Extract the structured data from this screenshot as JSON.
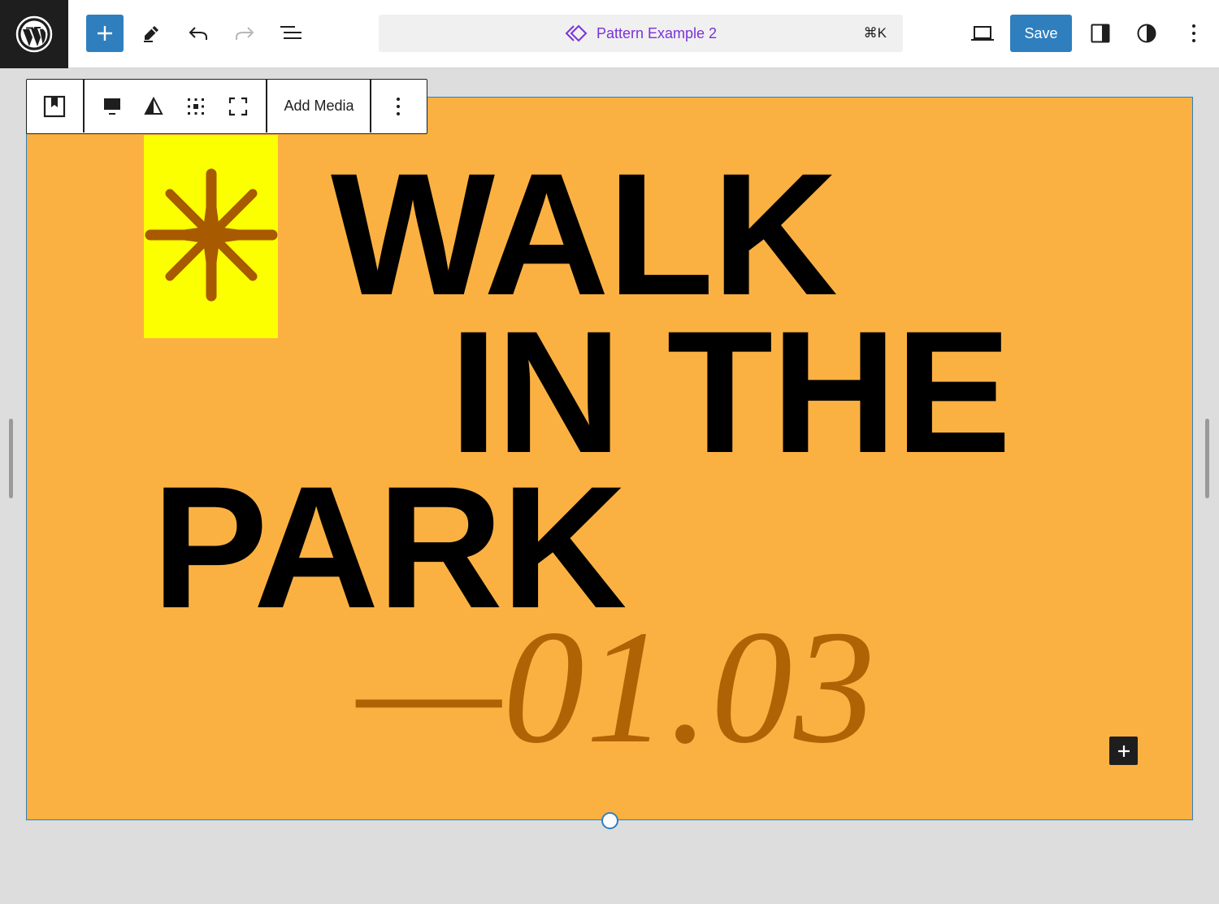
{
  "header": {
    "document_title": "Pattern Example 2",
    "command_shortcut": "⌘K",
    "save_label": "Save"
  },
  "icons": {
    "logo": "wordpress-logo",
    "inserter": "plus-icon",
    "tools": "pencil-icon",
    "undo": "undo-icon",
    "redo": "redo-icon",
    "list_view": "list-view-icon",
    "pattern": "pattern-diamond-icon",
    "preview": "laptop-icon",
    "settings": "sidebar-icon",
    "styles": "half-circle-icon",
    "options": "vertical-ellipsis-icon"
  },
  "block_toolbar": {
    "add_media_label": "Add Media"
  },
  "cover": {
    "line1": "WALK",
    "line2": "IN THE",
    "line3": "PARK",
    "date": "—01.03"
  },
  "colors": {
    "accent": "#2f7fbf",
    "cover_bg": "#fbb142",
    "star_box": "#fbff00",
    "star": "#a85a00",
    "date": "#b06304",
    "pattern_title": "#7a33d6"
  }
}
